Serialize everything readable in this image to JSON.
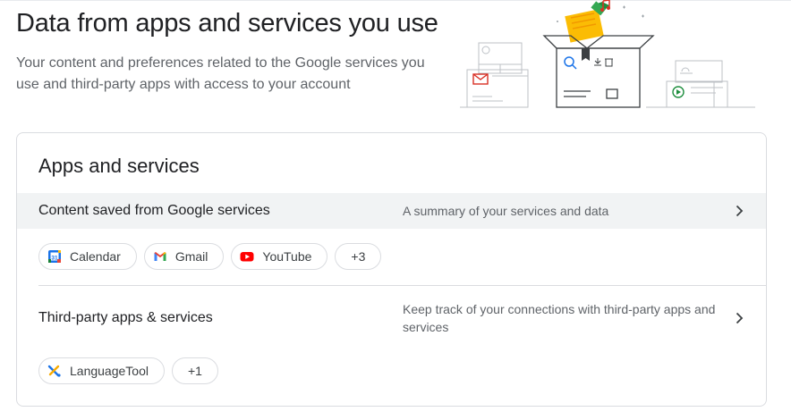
{
  "header": {
    "title": "Data from apps and services you use",
    "subtitle": "Your content and preferences related to the Google services you use and third-party apps with access to your account"
  },
  "card": {
    "title": "Apps and services",
    "google_services": {
      "label": "Content saved from Google services",
      "description": "A summary of your services and data",
      "chips": [
        {
          "label": "Calendar",
          "icon": "calendar-icon"
        },
        {
          "label": "Gmail",
          "icon": "gmail-icon"
        },
        {
          "label": "YouTube",
          "icon": "youtube-icon"
        }
      ],
      "more_label": "+3"
    },
    "third_party": {
      "label": "Third-party apps & services",
      "description": "Keep track of your connections with third-party apps and services",
      "chips": [
        {
          "label": "LanguageTool",
          "icon": "languagetool-icon"
        }
      ],
      "more_label": "+1"
    }
  },
  "colors": {
    "title": "#202124",
    "secondary_text": "#5f6368",
    "row_highlight": "#f1f3f4",
    "border": "#dadce0"
  }
}
